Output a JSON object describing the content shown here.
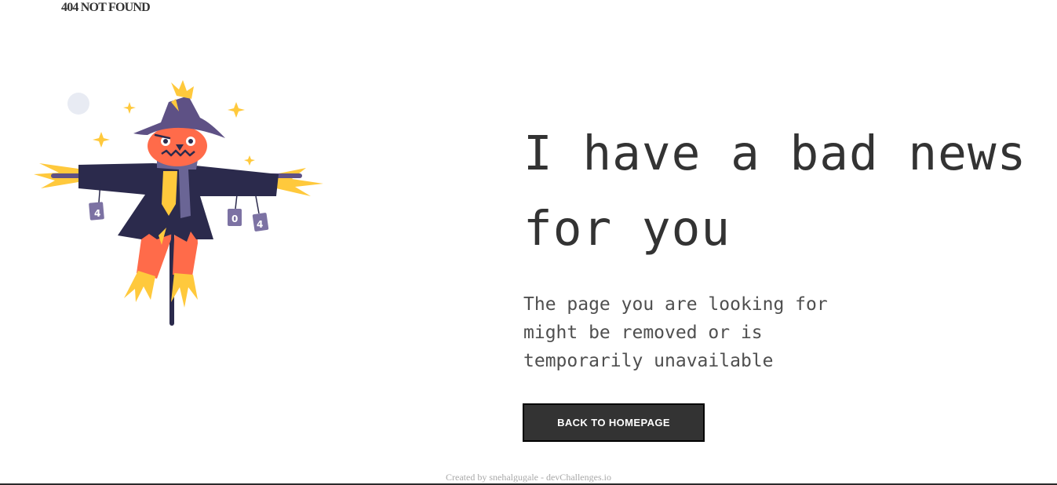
{
  "header": {
    "logo_text": "404 NOT FOUND"
  },
  "illustration": {
    "icon": "scarecrow-illustration",
    "can_labels": [
      "4",
      "0",
      "4"
    ],
    "colors": {
      "hat": "#5e5185",
      "coat": "#2b2a4c",
      "face": "#ff6b4a",
      "straw": "#ffc93c",
      "scarf": "#6a6595",
      "moon": "#e8ebf3",
      "can": "#7c72a3"
    }
  },
  "main": {
    "headline": "I have a bad news for you",
    "subtext": "The page you are looking for might be removed or is temporarily unavailable",
    "cta_label": "BACK TO HOMEPAGE"
  },
  "footer": {
    "credit": "Created by snehalgugale - devChallenges.io"
  },
  "theme": {
    "text": "#333333",
    "button_bg": "#333333",
    "button_text": "#ffffff",
    "footer_text": "#a9a9a9"
  }
}
